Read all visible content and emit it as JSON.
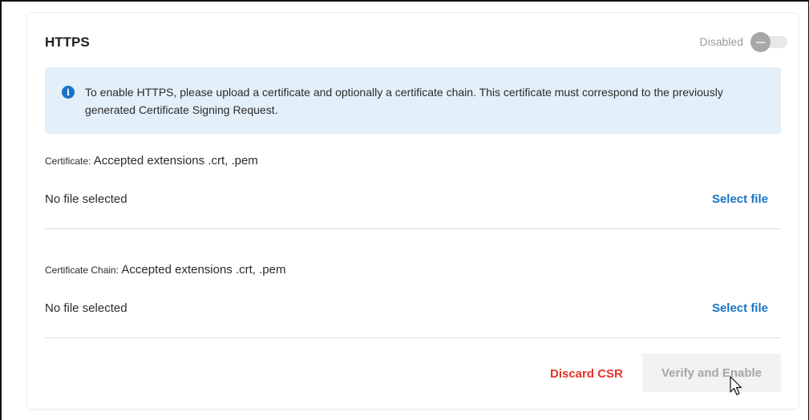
{
  "section": {
    "title": "HTTPS",
    "toggle": {
      "label": "Disabled",
      "state": "off"
    }
  },
  "info": {
    "icon": "info-icon",
    "text": "To enable HTTPS, please upload a certificate and optionally a certificate chain. This certificate must correspond to the previously generated Certificate Signing Request."
  },
  "certificate": {
    "label": "Certificate:",
    "extensions": " Accepted extensions .crt, .pem",
    "status": "No file selected",
    "select_label": "Select file"
  },
  "chain": {
    "label": "Certificate Chain:",
    "extensions": " Accepted extensions .crt, .pem",
    "status": "No file selected",
    "select_label": "Select file"
  },
  "actions": {
    "discard_label": "Discard CSR",
    "verify_label": "Verify and Enable"
  },
  "colors": {
    "accent": "#1a73c4",
    "danger": "#e5352a",
    "info_bg": "#e3eff9",
    "disabled_text": "#a6a6a6"
  }
}
